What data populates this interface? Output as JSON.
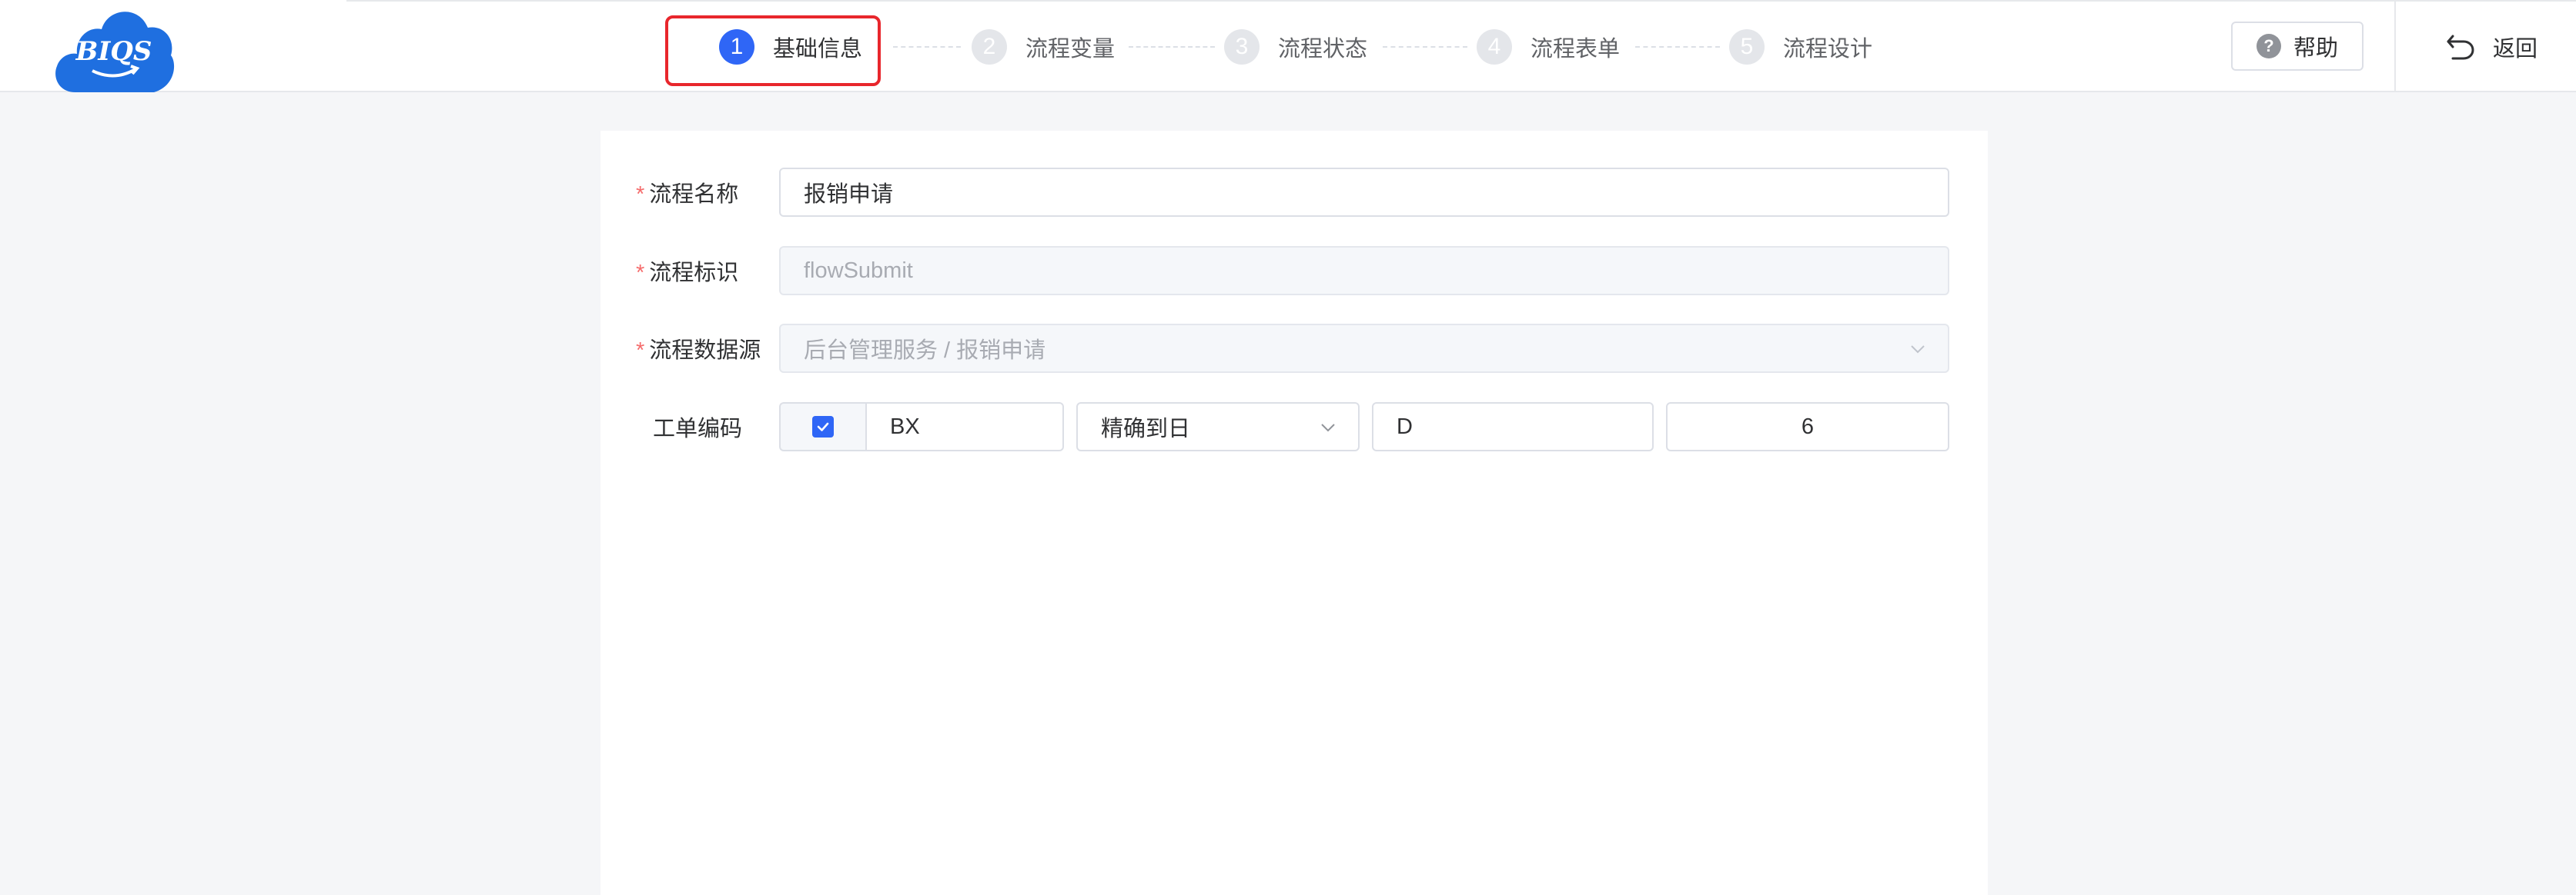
{
  "header": {
    "logo_text": "BIQS",
    "steps": [
      {
        "num": "1",
        "label": "基础信息",
        "active": true
      },
      {
        "num": "2",
        "label": "流程变量",
        "active": false
      },
      {
        "num": "3",
        "label": "流程状态",
        "active": false
      },
      {
        "num": "4",
        "label": "流程表单",
        "active": false
      },
      {
        "num": "5",
        "label": "流程设计",
        "active": false
      }
    ],
    "help_label": "帮助",
    "help_icon": "question-circle-icon",
    "back_label": "返回",
    "back_icon": "return-arrow-icon"
  },
  "form": {
    "required_mark": "*",
    "name": {
      "label": "流程名称",
      "value": "报销申请"
    },
    "key": {
      "label": "流程标识",
      "value": "flowSubmit"
    },
    "datasource": {
      "label": "流程数据源",
      "value": "后台管理服务 / 报销申请"
    },
    "code": {
      "label": "工单编码",
      "checked": true,
      "prefix": "BX",
      "precision": "精确到日",
      "suffix": "D",
      "length": "6"
    }
  },
  "colors": {
    "primary": "#2f66f6",
    "highlight": "#e8262c",
    "required": "#f56c6c",
    "logo": "#1f6fe0"
  }
}
